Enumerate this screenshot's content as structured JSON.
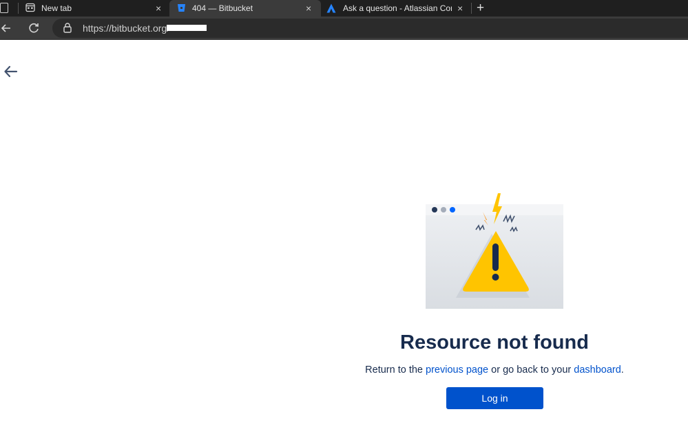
{
  "browser": {
    "tabs": [
      {
        "label": "New tab",
        "close": "×"
      },
      {
        "label": "404 — Bitbucket",
        "close": "×"
      },
      {
        "label": "Ask a question - Atlassian Comm",
        "close": "×"
      }
    ],
    "new_tab": "+",
    "address": {
      "url": "https://bitbucket.org/"
    }
  },
  "page": {
    "title": "Resource not found",
    "subtitle": {
      "prefix": "Return to the ",
      "link1": "previous page",
      "middle": " or go back to your ",
      "link2": "dashboard",
      "suffix": "."
    },
    "login_label": "Log in"
  },
  "colors": {
    "primary": "#0052cc",
    "heading": "#172b4d",
    "warning": "#ffc400"
  }
}
